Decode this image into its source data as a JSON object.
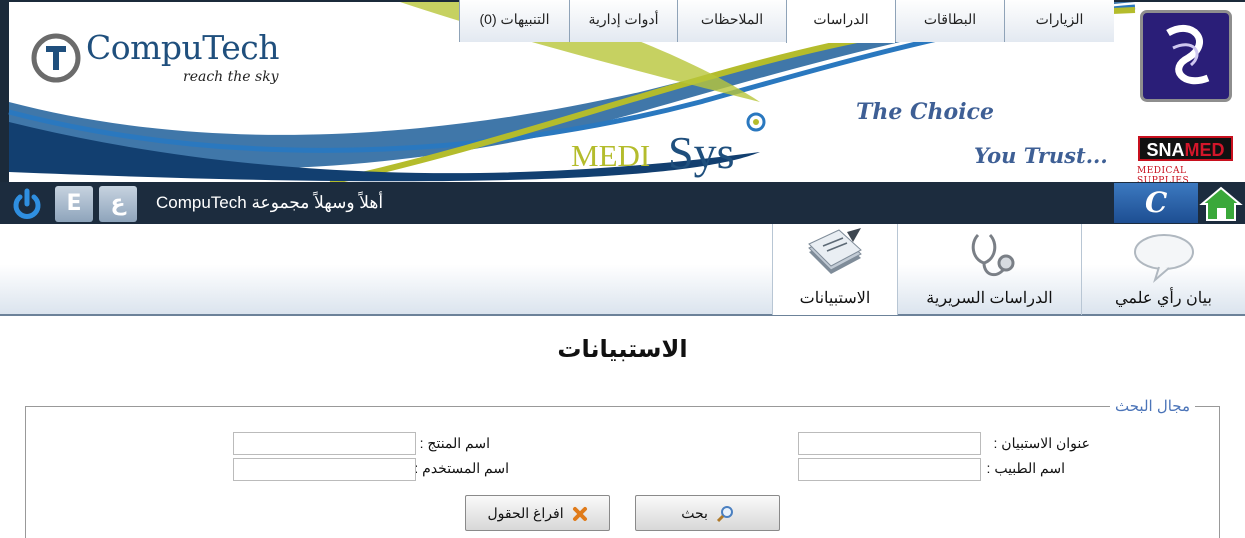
{
  "header": {
    "brand_name": "CompuTech",
    "brand_tagline": "reach the sky",
    "product_medi": "MEDI",
    "product_sys": "Sys",
    "slogan_line1": "The Choice",
    "slogan_line2": "You Trust...",
    "partner_prefix": "SNA",
    "partner_suffix": "MED",
    "partner_subtitle": "MEDICAL SUPPLIES"
  },
  "navbar": {
    "welcome": "أهلاً وسهلاً مجموعة CompuTech",
    "c_letter": "C",
    "language_buttons": [
      "E",
      "ع"
    ],
    "tabs": [
      {
        "label": "الزيارات"
      },
      {
        "label": "البطاقات"
      },
      {
        "label": "الدراسات"
      },
      {
        "label": "الملاحظات"
      },
      {
        "label": "أدوات إدارية"
      },
      {
        "label": "التنبيهات (0)"
      }
    ]
  },
  "submenu": {
    "items": [
      {
        "label": "بيان رأي علمي",
        "icon": "speech-bubble-icon"
      },
      {
        "label": "الدراسات السريرية",
        "icon": "stethoscope-icon"
      },
      {
        "label": "الاستبيانات",
        "icon": "documents-icon"
      }
    ]
  },
  "page": {
    "title": "الاستبيانات"
  },
  "search": {
    "legend": "مجال البحث",
    "fields": {
      "survey_title_label": "عنوان الاستبيان :",
      "survey_title_value": "",
      "doctor_name_label": "اسم الطبيب :",
      "doctor_name_value": "",
      "product_name_label": "اسم المنتج :",
      "product_name_value": "",
      "user_name_label": "اسم المستخدم :",
      "user_name_value": ""
    },
    "search_button": "بحث",
    "clear_button": "افراغ الحقول"
  },
  "colors": {
    "nav_dark": "#1c2c3e",
    "brand_blue": "#1f4f7d",
    "accent_olive": "#b4bc2c",
    "legend_blue": "#4b74b8"
  }
}
